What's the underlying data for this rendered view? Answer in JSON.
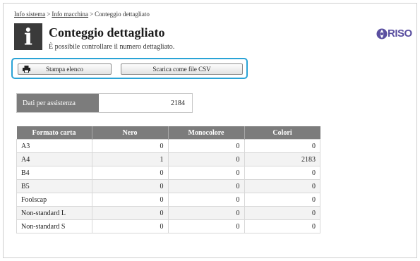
{
  "breadcrumb": {
    "items": [
      "Info sistema",
      "Info macchina",
      "Conteggio dettagliato"
    ],
    "separator": ">"
  },
  "page": {
    "title": "Conteggio dettagliato",
    "subtitle": "È possibile controllare il numero dettagliato.",
    "icon": "info-icon"
  },
  "logo": {
    "text": "RISO",
    "color": "#5a4fa0"
  },
  "toolbar": {
    "print_label": "Stampa elenco",
    "print_icon": "printer-icon",
    "csv_label": "Scarica come file CSV",
    "highlight_color": "#2aa3d6"
  },
  "assistance": {
    "label": "Dati per assistenza",
    "value": "2184"
  },
  "table": {
    "headers": [
      "Formato carta",
      "Nero",
      "Monocolore",
      "Colori"
    ],
    "rows": [
      [
        "A3",
        "0",
        "0",
        "0"
      ],
      [
        "A4",
        "1",
        "0",
        "2183"
      ],
      [
        "B4",
        "0",
        "0",
        "0"
      ],
      [
        "B5",
        "0",
        "0",
        "0"
      ],
      [
        "Foolscap",
        "0",
        "0",
        "0"
      ],
      [
        "Non-standard L",
        "0",
        "0",
        "0"
      ],
      [
        "Non-standard S",
        "0",
        "0",
        "0"
      ]
    ]
  }
}
